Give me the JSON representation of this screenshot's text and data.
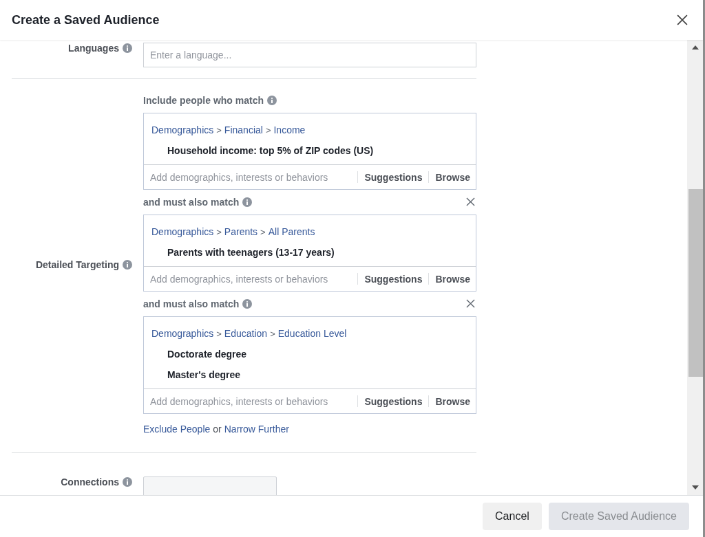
{
  "dialog": {
    "title": "Create a Saved Audience"
  },
  "sections": [
    {
      "kind": "input",
      "label": "Languages",
      "placeholder": "Enter a language..."
    },
    {
      "kind": "targeting",
      "label": "Detailed Targeting",
      "groups": [
        {
          "heading": "Include people who match",
          "removable": false,
          "path": [
            "Demographics",
            "Financial",
            "Income"
          ],
          "items": [
            "Household income: top 5% of ZIP codes (US)"
          ],
          "placeholder": "Add demographics, interests or behaviors",
          "actions": [
            "Suggestions",
            "Browse"
          ]
        },
        {
          "heading": "and must also match",
          "removable": true,
          "path": [
            "Demographics",
            "Parents",
            "All Parents"
          ],
          "items": [
            "Parents with teenagers (13-17 years)"
          ],
          "placeholder": "Add demographics, interests or behaviors",
          "actions": [
            "Suggestions",
            "Browse"
          ]
        },
        {
          "heading": "and must also match",
          "removable": true,
          "path": [
            "Demographics",
            "Education",
            "Education Level"
          ],
          "items": [
            "Doctorate degree",
            "Master's degree"
          ],
          "placeholder": "Add demographics, interests or behaviors",
          "actions": [
            "Suggestions",
            "Browse"
          ]
        }
      ],
      "separator": ">",
      "links": {
        "exclude": "Exclude People",
        "joiner": "or",
        "narrow": "Narrow Further"
      }
    },
    {
      "kind": "select",
      "label": "Connections"
    }
  ],
  "footer": {
    "buttons": [
      {
        "label": "Cancel",
        "disabled": false
      },
      {
        "label": "Create Saved Audience",
        "disabled": true
      }
    ]
  }
}
